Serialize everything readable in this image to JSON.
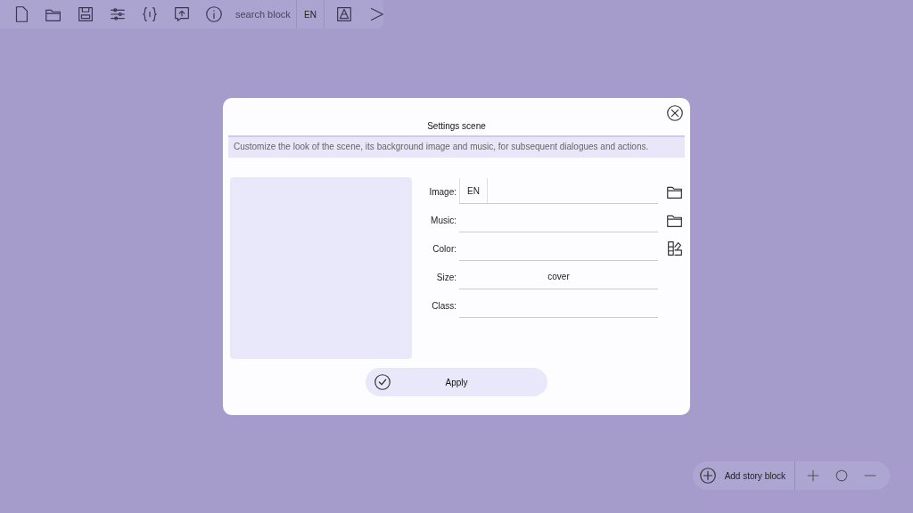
{
  "toolbar": {
    "search": {
      "placeholder": "search block"
    },
    "language": "EN"
  },
  "dialog": {
    "title": "Settings scene",
    "description": "Customize the look of the scene, its background image and music, for subsequent dialogues and actions.",
    "fields": [
      {
        "label": "Image:",
        "prefix": "EN",
        "kind": "file"
      },
      {
        "label": "Music:",
        "kind": "file"
      },
      {
        "label": "Color:",
        "kind": "color"
      },
      {
        "label": "Size:",
        "value": "cover",
        "kind": "text"
      },
      {
        "label": "Class:",
        "kind": "text"
      }
    ],
    "apply_button": "Apply"
  },
  "bottom_bar": {
    "add_button": "Add story block"
  }
}
